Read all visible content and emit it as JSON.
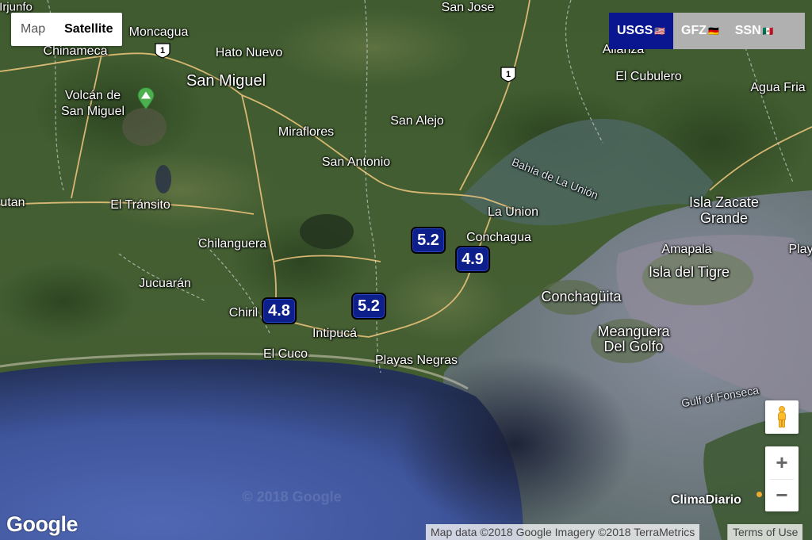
{
  "map_type": {
    "map_label": "Map",
    "satellite_label": "Satellite",
    "active": "Satellite"
  },
  "sources": [
    {
      "label": "USGS",
      "flag": "🇺🇸",
      "active": true
    },
    {
      "label": "GFZ",
      "flag": "🇩🇪",
      "active": false
    },
    {
      "label": "SSN",
      "flag": "🇲🇽",
      "active": false
    }
  ],
  "colors": {
    "marker_fill": "#0d1f8a",
    "source_active": "#0a1690",
    "source_inactive": "#b0b0b0",
    "land": "#3d5a2e",
    "sea": "#4a5fa8",
    "gulf": "#6f7f8a",
    "road": "#e8c27a"
  },
  "places": {
    "moncagua": "Moncagua",
    "chinameca": "Chinameca",
    "hato_nuevo": "Hato Nuevo",
    "san_miguel": "San Miguel",
    "volcan_line1": "Volcán de",
    "volcan_line2": "San Miguel",
    "miraflores": "Miraflores",
    "san_alejo": "San Alejo",
    "san_antonio": "San Antonio",
    "san_jose": "San Jose",
    "alianza": "Alianza",
    "el_cubulero": "El Cubulero",
    "agua_fria": "Agua Fria",
    "el_transito": "El Tránsito",
    "tutan": "utan",
    "chilanguera": "Chilanguera",
    "jucuaran": "Jucuarán",
    "chirilagua": "Chiril",
    "intipuca": "Intipucá",
    "el_cuco": "El Cuco",
    "playas_negras": "Playas Negras",
    "la_union": "La Union",
    "conchagua": "Conchagua",
    "conchaguita": "Conchagüita",
    "amapala": "Amapala",
    "isla_del_tigre": "Isla del Tigre",
    "isla_zacate_line1": "Isla Zacate",
    "isla_zacate_line2": "Grande",
    "meanguera_line1": "Meanguera",
    "meanguera_line2": "Del Golfo",
    "play_cut": "Play",
    "infunfo": "Irjunfo",
    "bahia": "Bahía de La Unión",
    "gulf_of_fonseca": "Gulf of Fonseca"
  },
  "route_shields": [
    {
      "number": "1"
    },
    {
      "number": "1"
    }
  ],
  "earthquakes": [
    {
      "magnitude": "5.2"
    },
    {
      "magnitude": "4.9"
    },
    {
      "magnitude": "5.2"
    },
    {
      "magnitude": "4.8"
    }
  ],
  "icons": {
    "volcano": "volcano-icon",
    "pegman": "street-view-pegman-icon",
    "zoom_in": "+",
    "zoom_out": "−"
  },
  "attribution": {
    "data": "Map data ©2018 Google Imagery ©2018 TerraMetrics",
    "terms": "Terms of Use"
  },
  "logo": "Google",
  "brand": "ClimaDiario",
  "watermark": "© 2018 Google"
}
